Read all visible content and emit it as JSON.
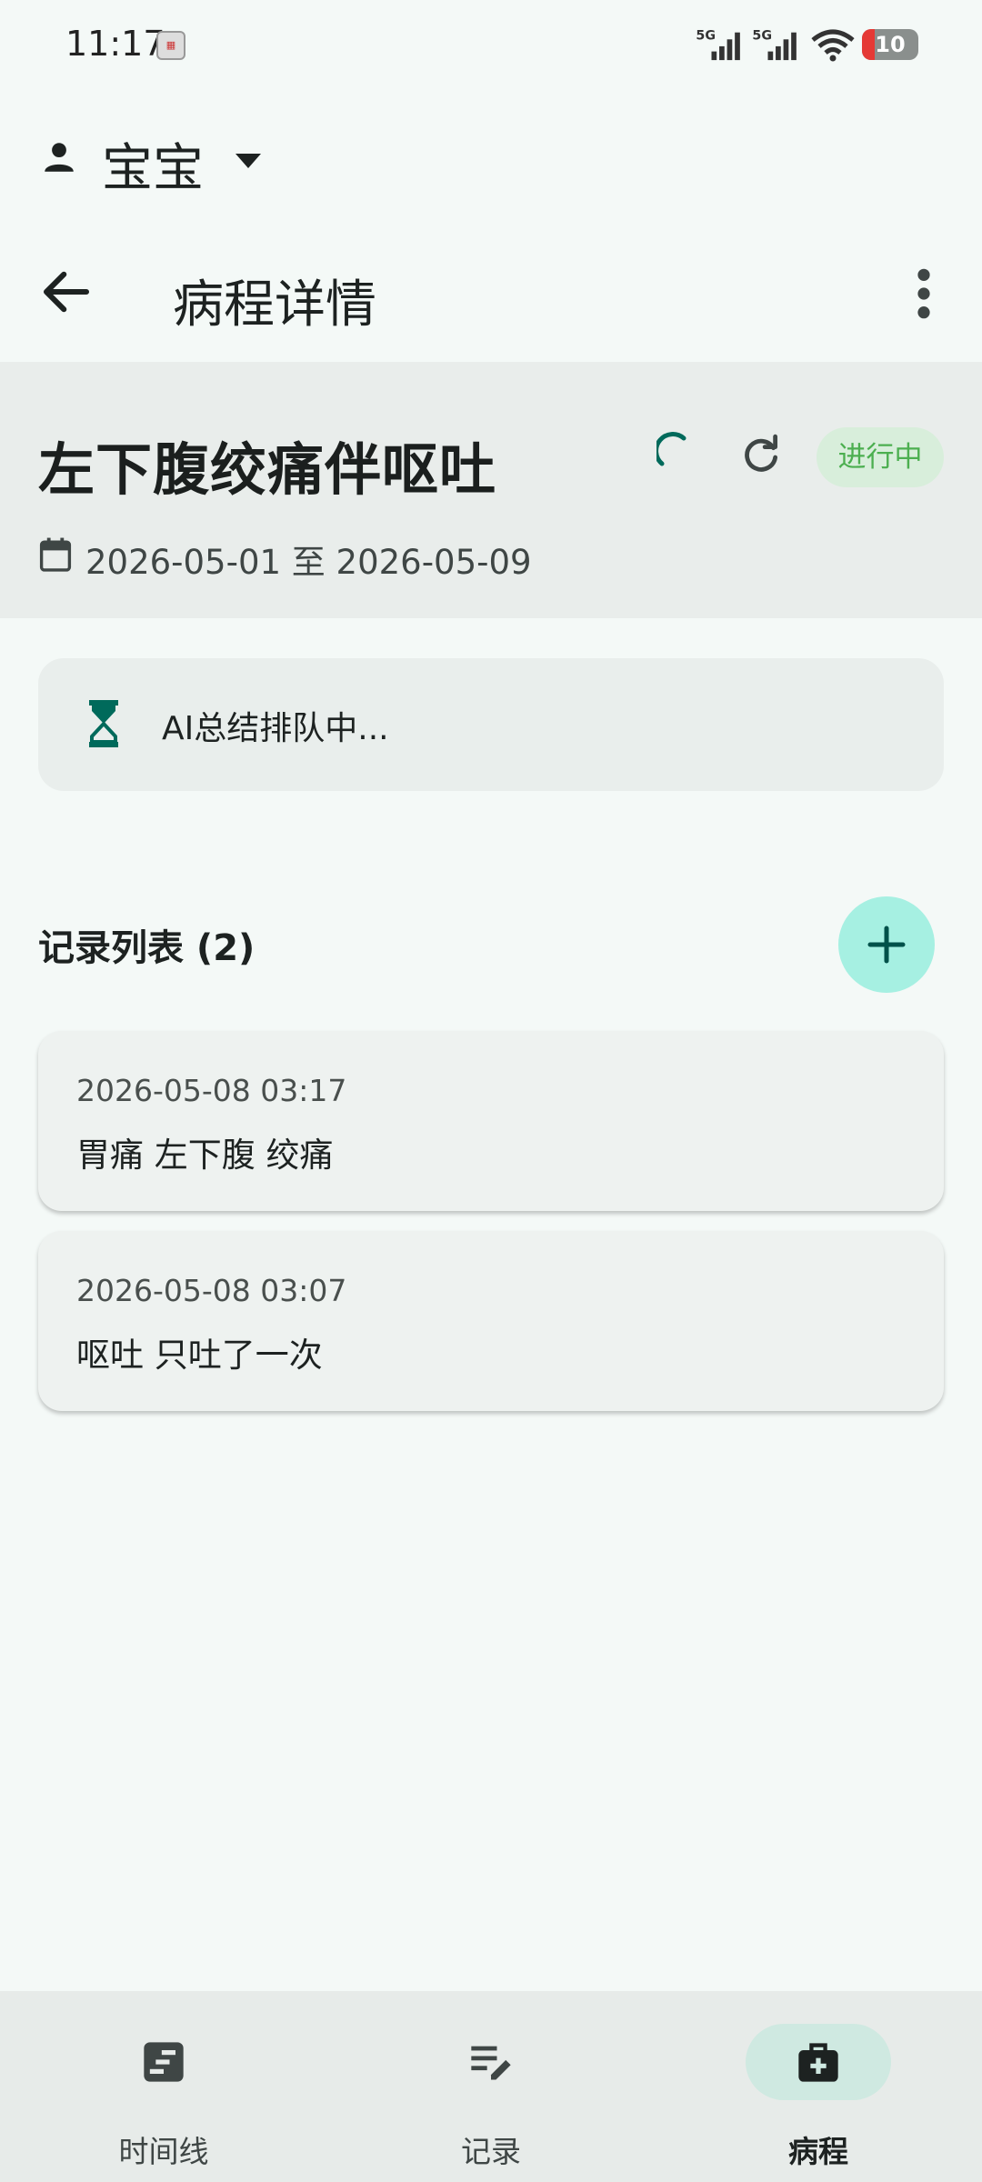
{
  "status_bar": {
    "time": "11:17",
    "signal_1": "5G",
    "signal_2": "5G",
    "battery": "10"
  },
  "profile": {
    "name": "宝宝",
    "icon": "person-icon"
  },
  "app_bar": {
    "title": "病程详情",
    "back_icon": "arrow-back-icon",
    "more_icon": "more-vert-icon"
  },
  "episode": {
    "title": "左下腹绞痛伴呕吐",
    "date_range": "2026-05-01 至 2026-05-09",
    "status": "进行中",
    "status_color": "#4caf50"
  },
  "ai_summary": {
    "status": "AI总结排队中..."
  },
  "records": {
    "heading": "记录列表 (2)",
    "items": [
      {
        "time": "2026-05-08 03:17",
        "text": "胃痛 左下腹 绞痛"
      },
      {
        "time": "2026-05-08 03:07",
        "text": "呕吐 只吐了一次"
      }
    ]
  },
  "bottom_nav": {
    "items": [
      {
        "label": "时间线",
        "icon": "timeline-icon"
      },
      {
        "label": "记录",
        "icon": "edit-note-icon"
      },
      {
        "label": "病程",
        "icon": "medical-bag-icon",
        "selected": true
      }
    ]
  },
  "colors": {
    "accent": "#006a5b",
    "fab": "#a6f0e2",
    "background": "#f4f9f7"
  }
}
